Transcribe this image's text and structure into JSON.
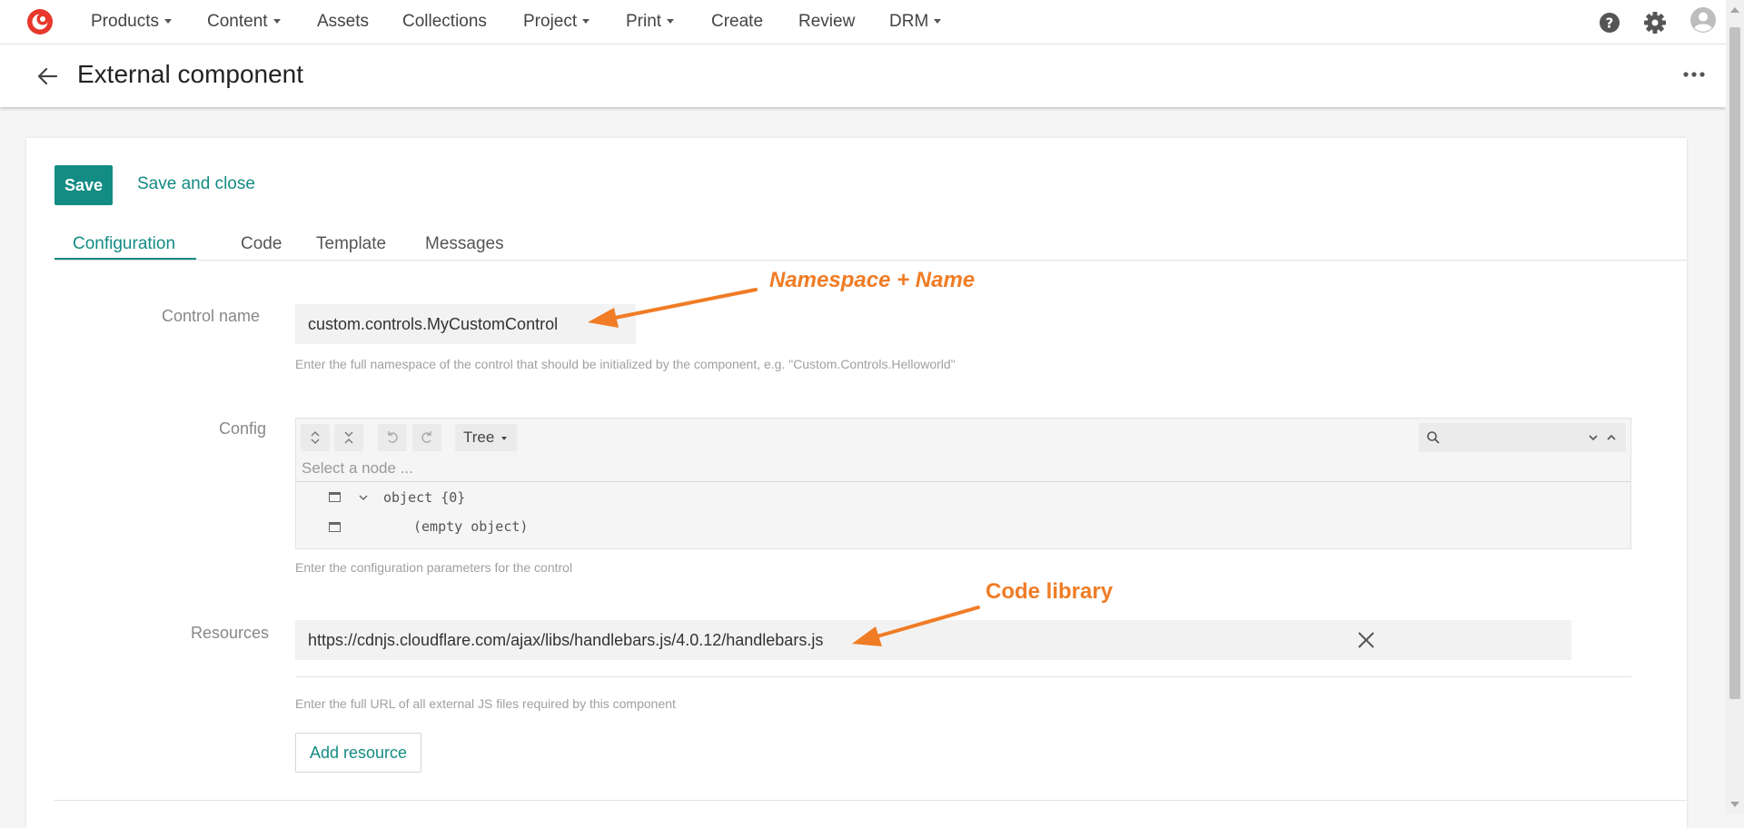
{
  "topnav": {
    "items": [
      {
        "label": "Products",
        "caret": true
      },
      {
        "label": "Content",
        "caret": true
      },
      {
        "label": "Assets",
        "caret": false
      },
      {
        "label": "Collections",
        "caret": false
      },
      {
        "label": "Project",
        "caret": true
      },
      {
        "label": "Print",
        "caret": true
      },
      {
        "label": "Create",
        "caret": false
      },
      {
        "label": "Review",
        "caret": false
      },
      {
        "label": "DRM",
        "caret": true
      }
    ],
    "right_icons": [
      "help-icon",
      "gear-icon",
      "user-avatar-icon"
    ]
  },
  "header": {
    "title": "External component"
  },
  "actions": {
    "save_label": "Save",
    "save_close_label": "Save and close"
  },
  "tabs": [
    {
      "label": "Configuration",
      "active": true
    },
    {
      "label": "Code",
      "active": false
    },
    {
      "label": "Template",
      "active": false
    },
    {
      "label": "Messages",
      "active": false
    }
  ],
  "form": {
    "control_name": {
      "label": "Control name",
      "value": "custom.controls.MyCustomControl",
      "hint": "Enter the full namespace of the control that should be initialized by the component, e.g. \"Custom.Controls.Helloworld\""
    },
    "config": {
      "label": "Config",
      "mode": "Tree",
      "nav_placeholder": "Select a node ...",
      "rows": [
        "object {0}",
        "(empty object)"
      ],
      "hint": "Enter the configuration parameters for the control"
    },
    "resources": {
      "label": "Resources",
      "value": "https://cdnjs.cloudflare.com/ajax/libs/handlebars.js/4.0.12/handlebars.js",
      "hint": "Enter the full URL of all external JS files required by this component",
      "add_label": "Add resource"
    }
  },
  "annotations": {
    "namespace": "Namespace + Name",
    "code_library": "Code library"
  },
  "colors": {
    "accent": "#138c83",
    "annotation": "#f07c25",
    "logo": "#e8372c"
  }
}
